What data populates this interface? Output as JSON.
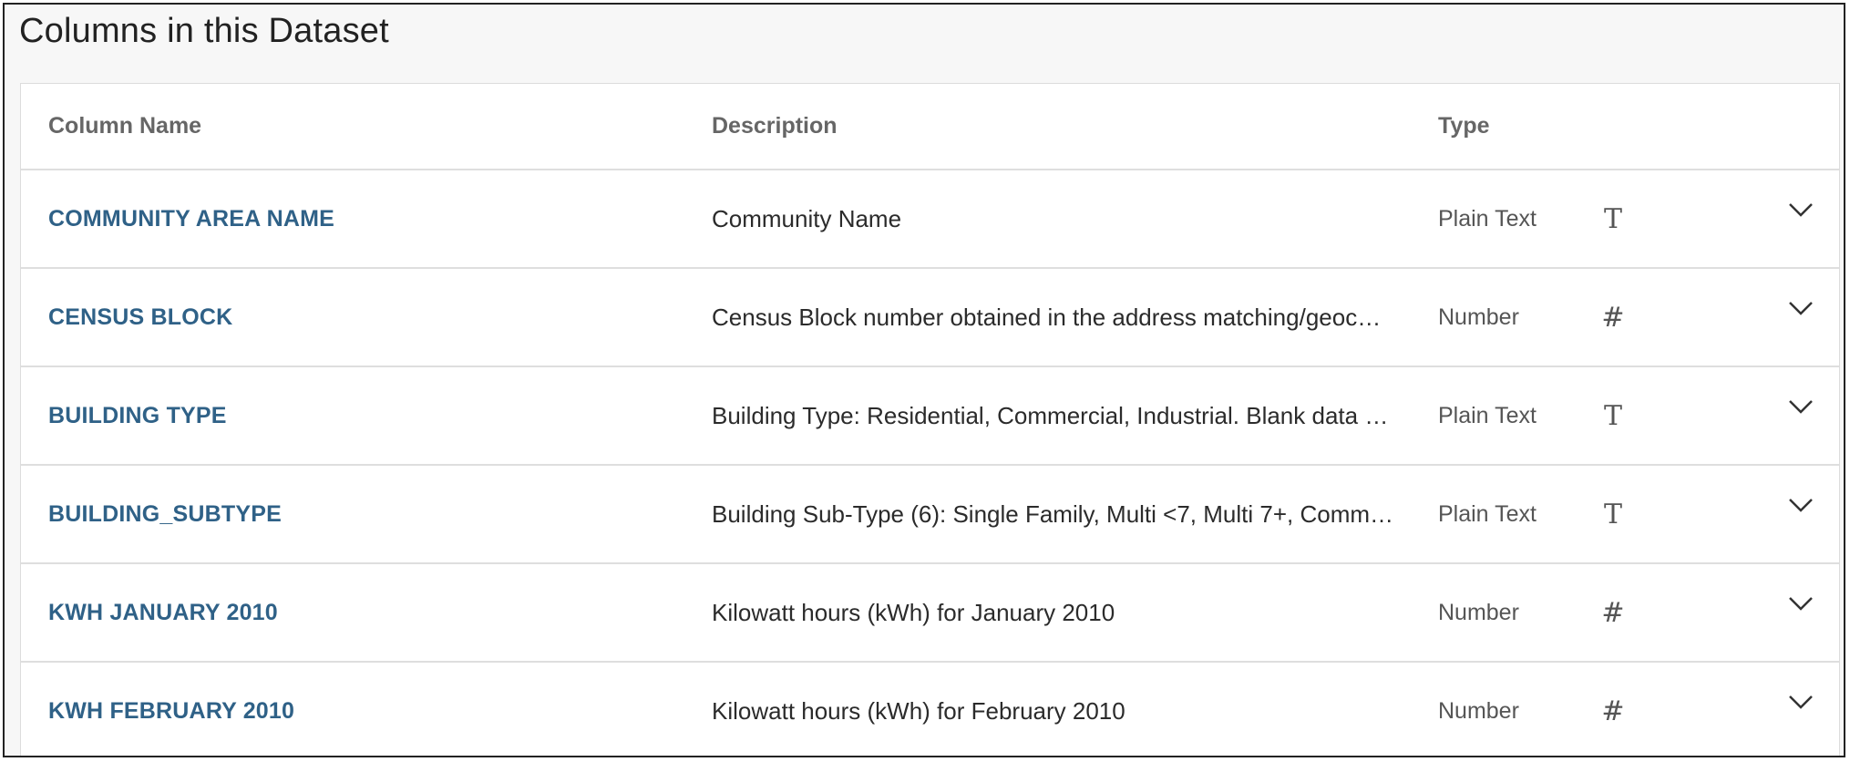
{
  "section": {
    "title": "Columns in this Dataset"
  },
  "table": {
    "headers": {
      "name": "Column Name",
      "description": "Description",
      "type": "Type"
    },
    "rows": [
      {
        "name": "COMMUNITY AREA NAME",
        "description": "Community Name",
        "type": "Plain Text",
        "icon": "T",
        "icon_name": "text-type-icon"
      },
      {
        "name": "CENSUS BLOCK",
        "description": "Census Block number obtained in the address matching/geoc…",
        "type": "Number",
        "icon": "#",
        "icon_name": "number-type-icon"
      },
      {
        "name": "BUILDING TYPE",
        "description": "Building Type: Residential, Commercial, Industrial. Blank data …",
        "type": "Plain Text",
        "icon": "T",
        "icon_name": "text-type-icon"
      },
      {
        "name": "BUILDING_SUBTYPE",
        "description": "Building Sub-Type (6): Single Family, Multi <7, Multi 7+, Comm…",
        "type": "Plain Text",
        "icon": "T",
        "icon_name": "text-type-icon"
      },
      {
        "name": "KWH JANUARY 2010",
        "description": "Kilowatt hours (kWh) for January 2010",
        "type": "Number",
        "icon": "#",
        "icon_name": "number-type-icon"
      },
      {
        "name": "KWH FEBRUARY 2010",
        "description": "Kilowatt hours (kWh) for February 2010",
        "type": "Number",
        "icon": "#",
        "icon_name": "number-type-icon"
      }
    ]
  },
  "colors": {
    "link": "#2f6187",
    "header_text": "#666666",
    "border": "#dedede"
  }
}
